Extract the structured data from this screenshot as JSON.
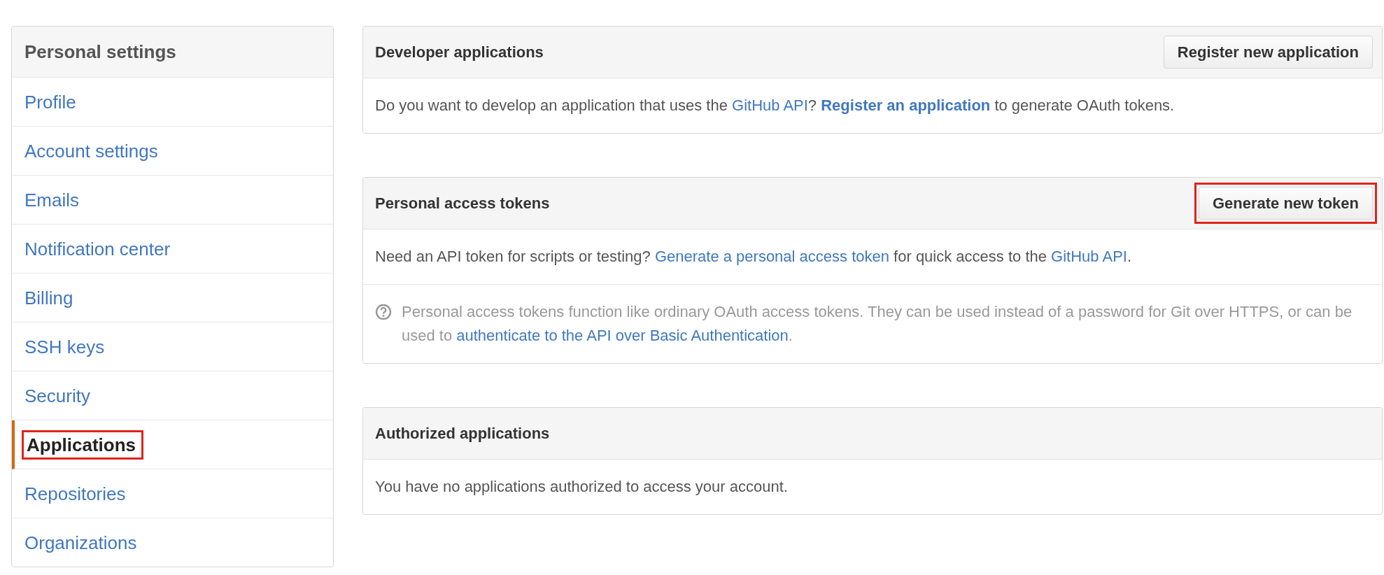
{
  "sidebar": {
    "title": "Personal settings",
    "items": [
      {
        "label": "Profile",
        "selected": false,
        "highlighted": false
      },
      {
        "label": "Account settings",
        "selected": false,
        "highlighted": false
      },
      {
        "label": "Emails",
        "selected": false,
        "highlighted": false
      },
      {
        "label": "Notification center",
        "selected": false,
        "highlighted": false
      },
      {
        "label": "Billing",
        "selected": false,
        "highlighted": false
      },
      {
        "label": "SSH keys",
        "selected": false,
        "highlighted": false
      },
      {
        "label": "Security",
        "selected": false,
        "highlighted": false
      },
      {
        "label": "Applications",
        "selected": true,
        "highlighted": true
      },
      {
        "label": "Repositories",
        "selected": false,
        "highlighted": false
      },
      {
        "label": "Organizations",
        "selected": false,
        "highlighted": false
      }
    ]
  },
  "panels": [
    {
      "title": "Developer applications",
      "button": {
        "label": "Register new application",
        "highlighted": false
      },
      "rows": [
        {
          "kind": "text",
          "segments": [
            {
              "kind": "text",
              "text": "Do you want to develop an application that uses the "
            },
            {
              "kind": "link",
              "text": "GitHub API"
            },
            {
              "kind": "text",
              "text": "? "
            },
            {
              "kind": "strong_link",
              "text": "Register an application"
            },
            {
              "kind": "text",
              "text": " to generate OAuth tokens."
            }
          ]
        }
      ]
    },
    {
      "title": "Personal access tokens",
      "button": {
        "label": "Generate new token",
        "highlighted": true
      },
      "rows": [
        {
          "kind": "text",
          "segments": [
            {
              "kind": "text",
              "text": "Need an API token for scripts or testing? "
            },
            {
              "kind": "link",
              "text": "Generate a personal access token"
            },
            {
              "kind": "text",
              "text": " for quick access to the "
            },
            {
              "kind": "link",
              "text": "GitHub API"
            },
            {
              "kind": "text",
              "text": "."
            }
          ]
        },
        {
          "kind": "note",
          "segments": [
            {
              "kind": "text",
              "text": "Personal access tokens function like ordinary OAuth access tokens. They can be used instead of a password for Git over HTTPS, or can be used to "
            },
            {
              "kind": "link",
              "text": "authenticate to the API over Basic Authentication"
            },
            {
              "kind": "text",
              "text": "."
            }
          ]
        }
      ]
    },
    {
      "title": "Authorized applications",
      "rows": [
        {
          "kind": "text",
          "segments": [
            {
              "kind": "text",
              "text": "You have no applications authorized to access your account."
            }
          ]
        }
      ]
    }
  ]
}
